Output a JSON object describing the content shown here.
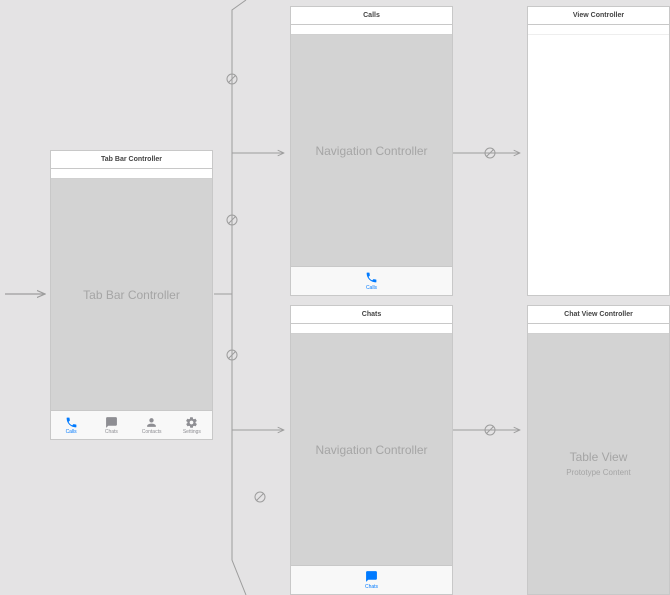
{
  "scenes": {
    "tabbar": {
      "title": "Tab Bar Controller",
      "body": "Tab Bar Controller",
      "tabs": [
        {
          "label": "Calls",
          "icon": "phone-icon",
          "active": true
        },
        {
          "label": "Chats",
          "icon": "chat-icon",
          "active": false
        },
        {
          "label": "Contacts",
          "icon": "contact-icon",
          "active": false
        },
        {
          "label": "Settings",
          "icon": "gear-icon",
          "active": false
        }
      ]
    },
    "navCalls": {
      "title": "Calls",
      "body": "Navigation Controller",
      "tab": {
        "label": "Calls",
        "icon": "phone-icon"
      }
    },
    "navChats": {
      "title": "Chats",
      "body": "Navigation Controller",
      "tab": {
        "label": "Chats",
        "icon": "chat-icon"
      }
    },
    "viewCtrl": {
      "title": "View Controller",
      "body": ""
    },
    "chatViewCtrl": {
      "title": "Chat View Controller",
      "body": "Table View",
      "sub": "Prototype Content"
    }
  }
}
